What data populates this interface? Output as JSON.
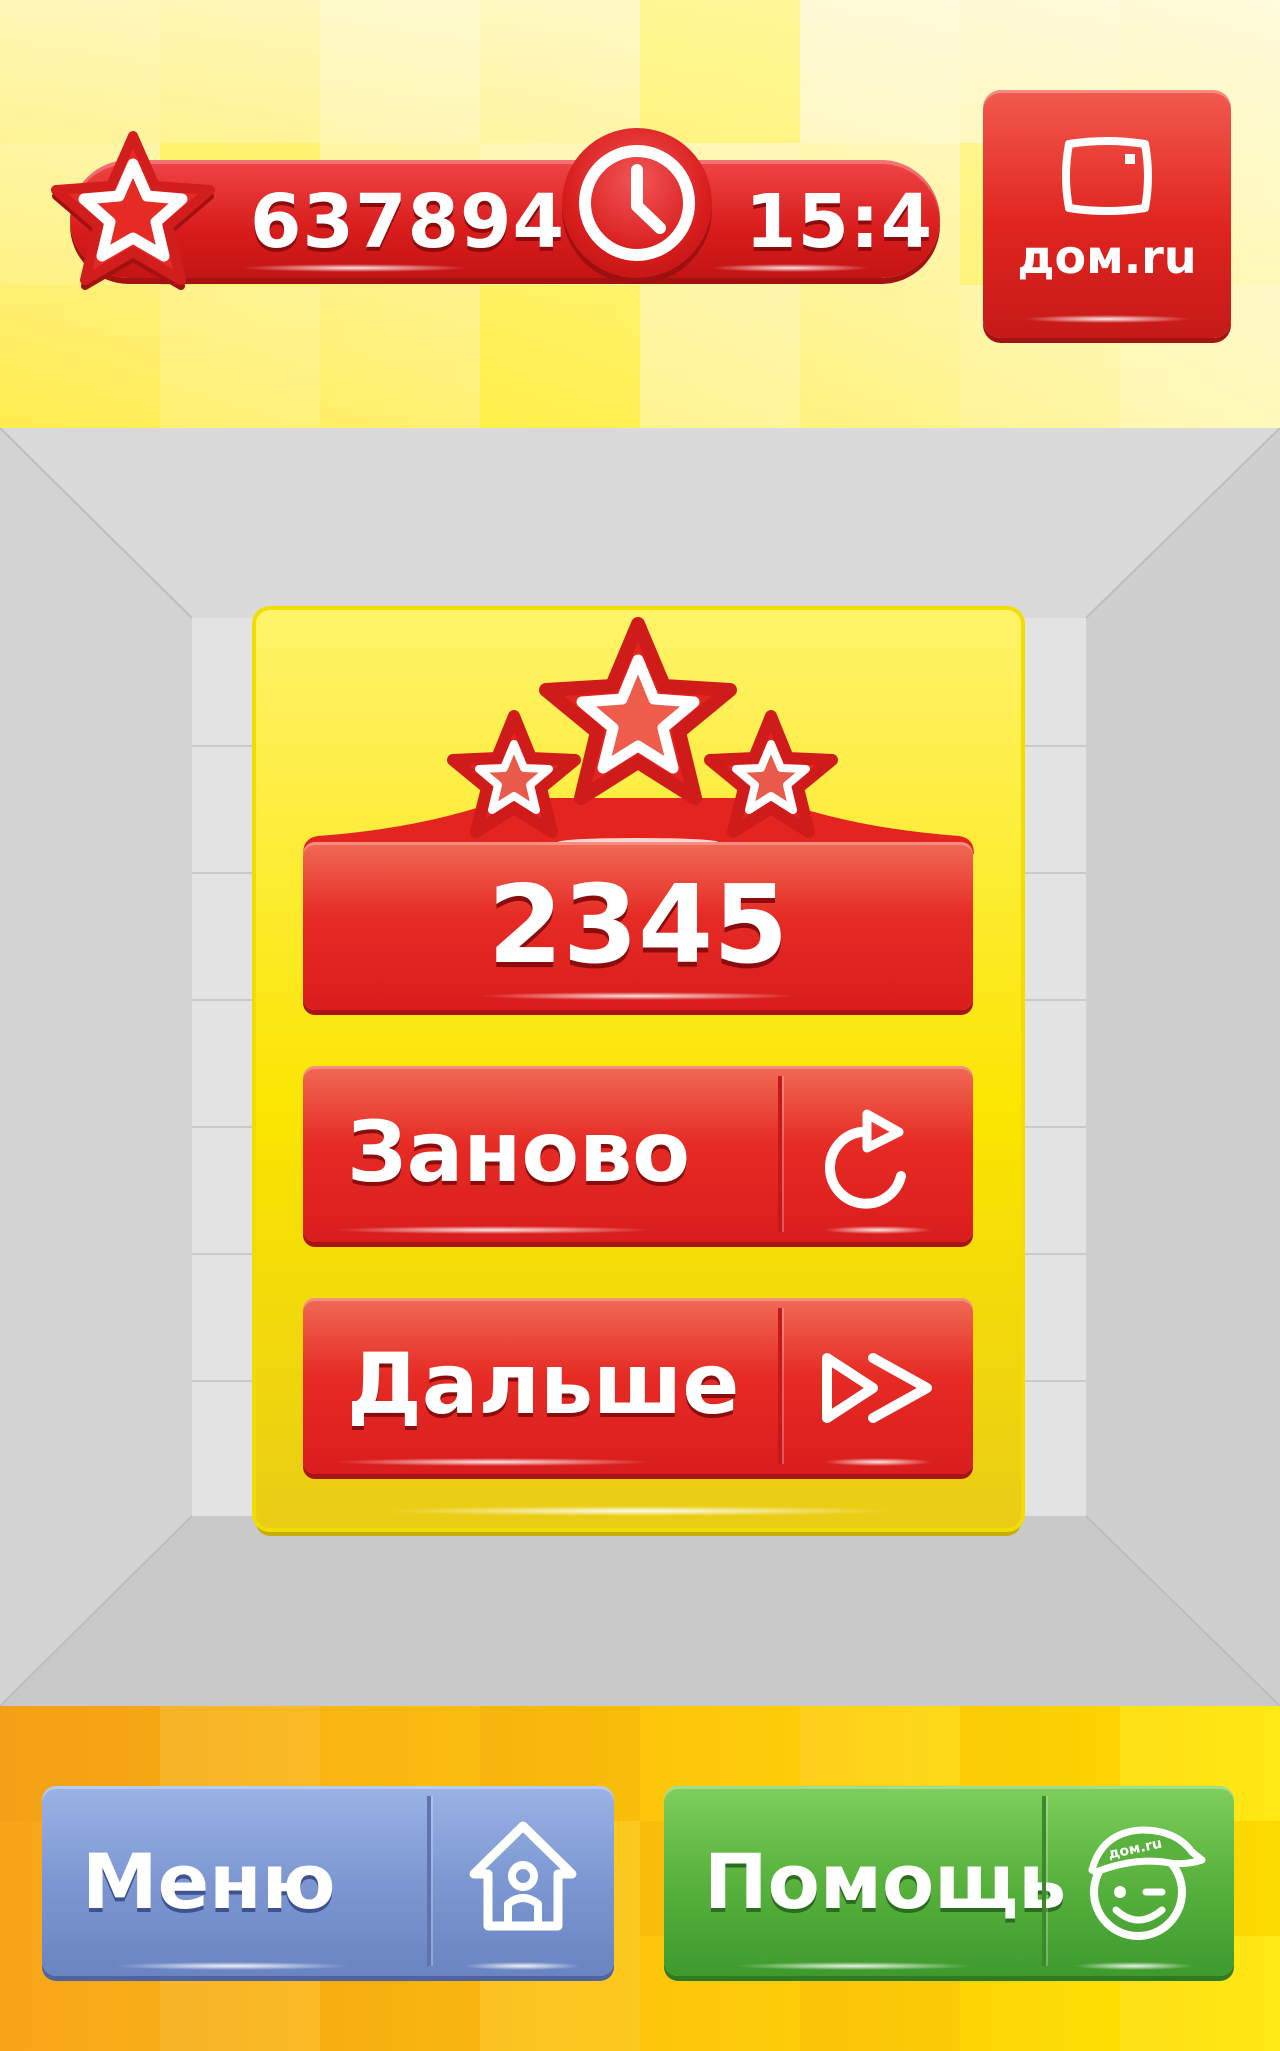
{
  "hud": {
    "score": "637894",
    "time": "15:4"
  },
  "brand": {
    "label": "дом.ru"
  },
  "result": {
    "stars_earned": 3,
    "stars_total": 3,
    "level_score": "2345",
    "restart_label": "Заново",
    "next_label": "Дальше"
  },
  "bottom": {
    "menu_label": "Меню",
    "help_label": "Помощь",
    "mascot_cap_text": "дом.ru"
  },
  "colors": {
    "primary_red": "#e0241f",
    "yellow": "#fde800",
    "menu_blue": "#7d97d2",
    "help_green": "#58b23d"
  },
  "icons": [
    "star-icon",
    "clock-icon",
    "tv-icon",
    "restart-icon",
    "fast-forward-icon",
    "home-icon",
    "mascot-icon"
  ]
}
